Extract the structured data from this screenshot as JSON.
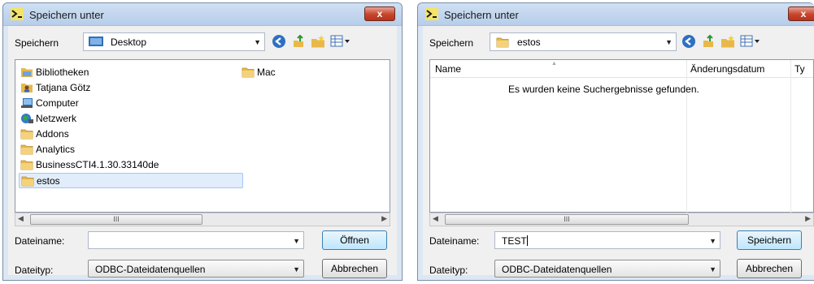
{
  "left_dialog": {
    "title": "Speichern unter",
    "close_label": "x",
    "look_in_label": "Speichern",
    "look_in_value": "Desktop",
    "items": [
      {
        "label": "Bibliotheken",
        "icon": "libraries-icon"
      },
      {
        "label": "Tatjana Götz",
        "icon": "user-folder-icon"
      },
      {
        "label": "Computer",
        "icon": "computer-icon"
      },
      {
        "label": "Netzwerk",
        "icon": "network-icon"
      },
      {
        "label": "Addons",
        "icon": "folder-icon"
      },
      {
        "label": "Analytics",
        "icon": "folder-icon"
      },
      {
        "label": "BusinessCTI4.1.30.33140de",
        "icon": "folder-icon"
      },
      {
        "label": "estos",
        "icon": "folder-icon",
        "selected": true
      },
      {
        "label": "Mac",
        "icon": "folder-icon"
      }
    ],
    "scroll_thumb": "III",
    "filename_label": "Dateiname:",
    "filename_value": "",
    "filetype_label": "Dateityp:",
    "filetype_value": "ODBC-Dateidatenquellen",
    "primary_button": "Öffnen",
    "cancel_button": "Abbrechen"
  },
  "right_dialog": {
    "title": "Speichern unter",
    "close_label": "x",
    "look_in_label": "Speichern",
    "look_in_value": "estos",
    "columns": [
      "Name",
      "Änderungsdatum",
      "Ty"
    ],
    "empty_message": "Es wurden keine Suchergebnisse gefunden.",
    "scroll_thumb": "III",
    "filename_label": "Dateiname:",
    "filename_value": "TEST",
    "filetype_label": "Dateityp:",
    "filetype_value": "ODBC-Dateidatenquellen",
    "primary_button": "Speichern",
    "cancel_button": "Abbrechen"
  },
  "colors": {
    "title_bar": "#b7cde9",
    "close_button": "#c7442c",
    "selection": "#e1edfb",
    "folder": "#e8b84a"
  }
}
